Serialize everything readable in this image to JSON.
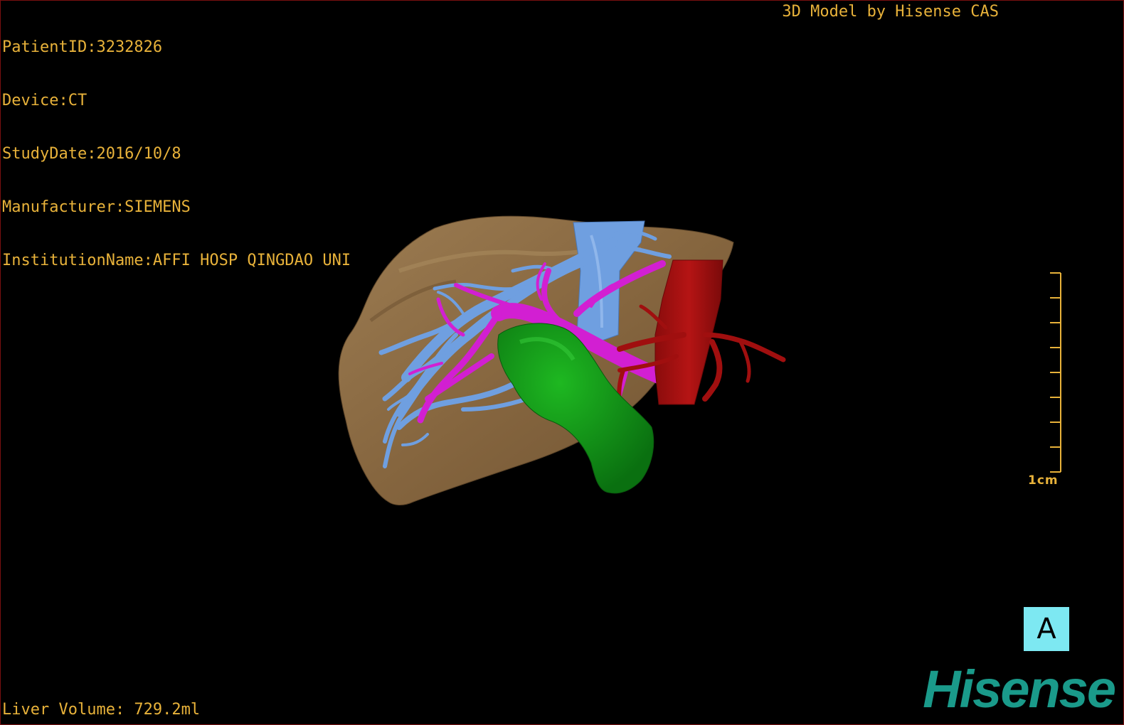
{
  "header": {
    "patient_id": "PatientID:3232826",
    "device": "Device:CT",
    "study_date": "StudyDate:2016/10/8",
    "manufacturer": "Manufacturer:SIEMENS",
    "institution": "InstitutionName:AFFI HOSP QINGDAO UNI",
    "credit": "3D Model by Hisense CAS"
  },
  "footer": {
    "liver_volume": "Liver Volume: 729.2ml"
  },
  "scale": {
    "label": "1cm"
  },
  "orientation": {
    "label": "A"
  },
  "brand": {
    "logo_text": "Hisense"
  },
  "colors": {
    "overlay_text": "#e8b23a",
    "liver": "#8a6a44",
    "hepatic_vein": "#6f9fe0",
    "portal_vein": "#d21fd2",
    "gallbladder": "#139a16",
    "artery": "#a00f0f",
    "orientation_cube": "#7de8f2",
    "brand": "#1a9a8a"
  }
}
